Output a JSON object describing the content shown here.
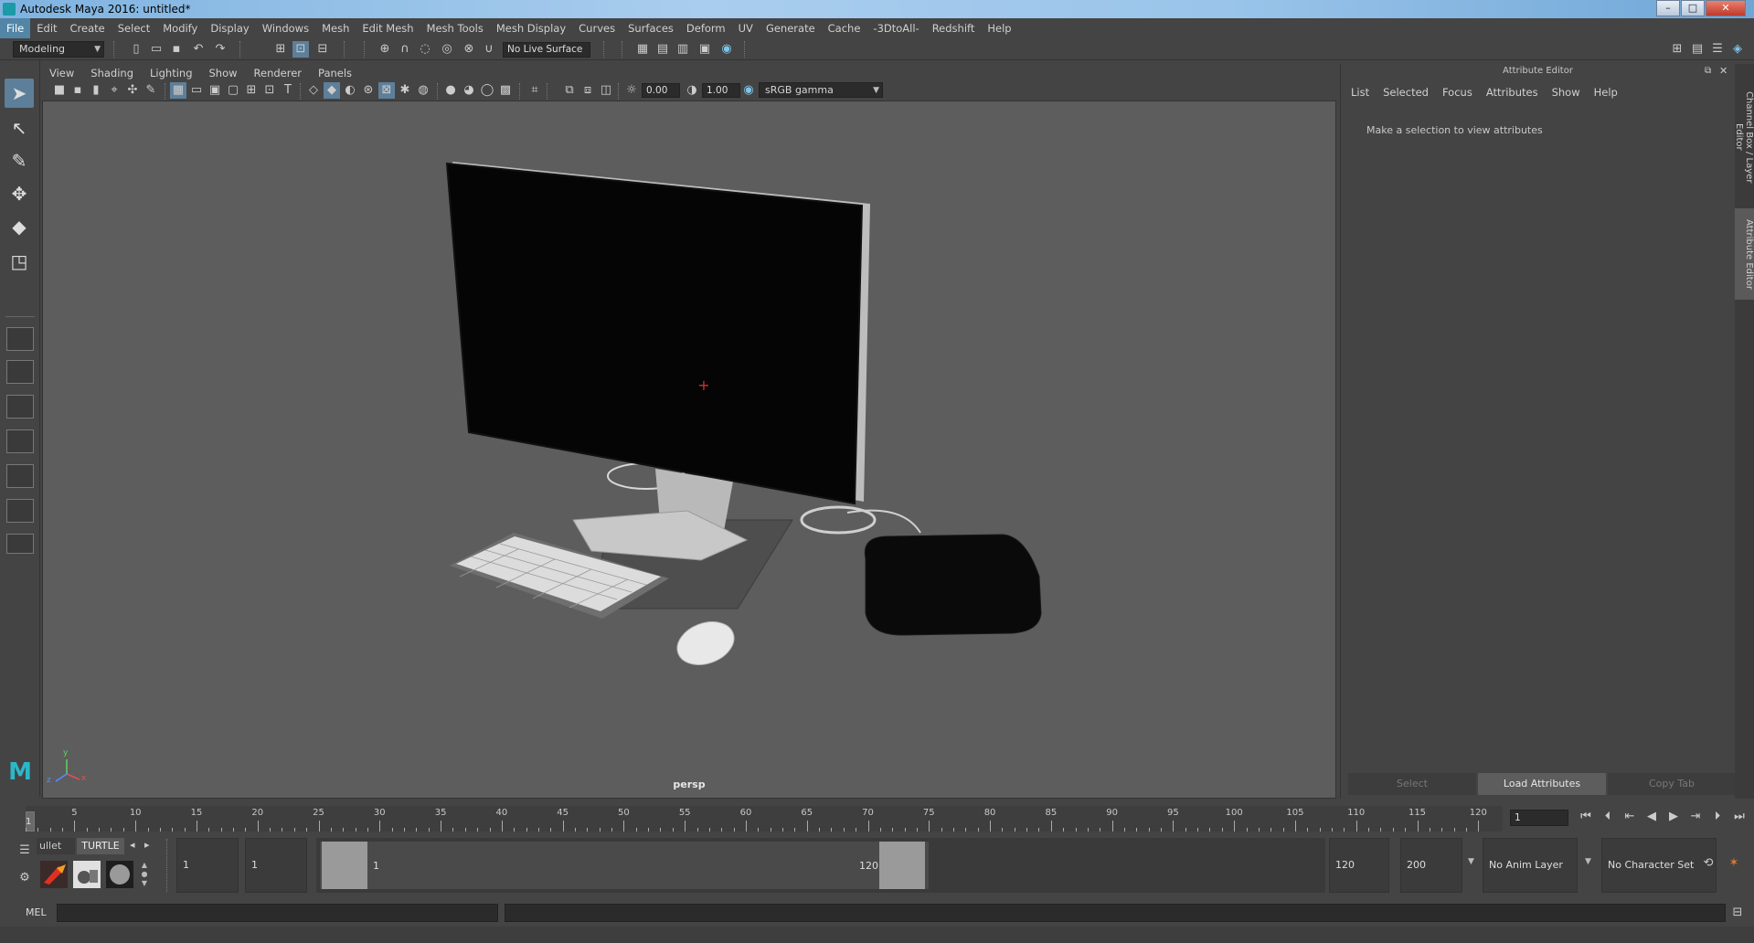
{
  "window": {
    "title": "Autodesk Maya 2016: untitled*",
    "controls": {
      "minimize": "–",
      "maximize": "□",
      "close": "✕"
    }
  },
  "menubar": [
    "File",
    "Edit",
    "Create",
    "Select",
    "Modify",
    "Display",
    "Windows",
    "Mesh",
    "Edit Mesh",
    "Mesh Tools",
    "Mesh Display",
    "Curves",
    "Surfaces",
    "Deform",
    "UV",
    "Generate",
    "Cache",
    "-3DtoAll-",
    "Redshift",
    "Help"
  ],
  "statusline": {
    "menuset": "Modeling",
    "live_surface": "No Live Surface"
  },
  "viewport": {
    "menu": [
      "View",
      "Shading",
      "Lighting",
      "Show",
      "Renderer",
      "Panels"
    ],
    "field_a": "0.00",
    "field_b": "1.00",
    "color_space": "sRGB gamma",
    "camera_label": "persp",
    "axis": {
      "x": "x",
      "y": "y",
      "z": "z"
    }
  },
  "attribute_editor": {
    "title": "Attribute Editor",
    "menu": [
      "List",
      "Selected",
      "Focus",
      "Attributes",
      "Show",
      "Help"
    ],
    "message": "Make a selection to view attributes",
    "buttons": {
      "select": "Select",
      "load": "Load Attributes",
      "copy": "Copy Tab"
    }
  },
  "side_tabs": {
    "channel_box": "Channel Box / Layer Editor",
    "attribute_editor": "Attribute Editor"
  },
  "time_slider": {
    "ticks": [
      "5",
      "10",
      "15",
      "20",
      "25",
      "30",
      "35",
      "40",
      "45",
      "50",
      "55",
      "60",
      "65",
      "70",
      "75",
      "80",
      "85",
      "90",
      "95",
      "100",
      "105",
      "110",
      "115",
      "120"
    ],
    "start_label": "1",
    "current_frame": "1"
  },
  "shelf": {
    "tabs": {
      "bullet": "ullet",
      "turtle": "TURTLE"
    },
    "arrows": {
      "left": "◂",
      "right": "▸"
    }
  },
  "range": {
    "start": "1",
    "playback_start": "1",
    "slider_start": "1",
    "slider_end": "120",
    "playback_end": "120",
    "end": "200",
    "anim_layer": "No Anim Layer",
    "character_set": "No Character Set"
  },
  "command_line": {
    "lang": "MEL"
  }
}
